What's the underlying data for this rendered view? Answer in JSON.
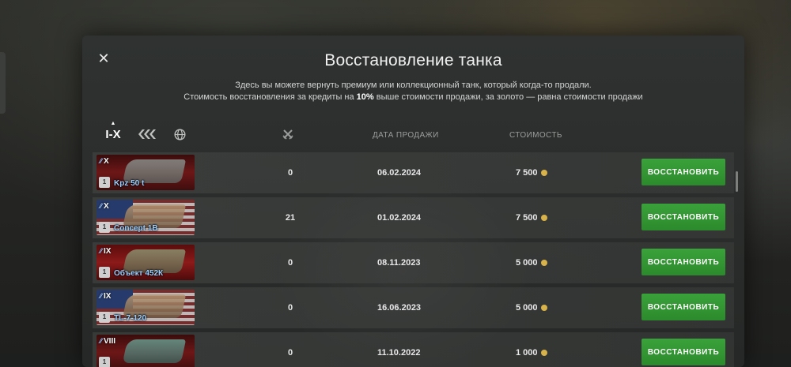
{
  "dialog": {
    "title": "Восстановление танка",
    "desc_line1": "Здесь вы можете вернуть премиум или коллекционный танк, который когда-то продали.",
    "desc_line2_pre": "Стоимость восстановления за кредиты на ",
    "desc_line2_bold": "10%",
    "desc_line2_post": " выше стоимости продажи, за золото — равна стоимости продажи"
  },
  "filters": {
    "tier_label": "I-X",
    "tier_arrow": "▲"
  },
  "columns": {
    "sale_date": "ДАТА ПРОДАЖИ",
    "cost": "СТОИМОСТЬ"
  },
  "rows": [
    {
      "tier": "X",
      "name": "Kpz 50 t",
      "battles": "0",
      "date": "06.02.2024",
      "cost": "7 500",
      "button": "ВОССТАНОВИТЬ"
    },
    {
      "tier": "X",
      "name": "Concept 1B",
      "battles": "21",
      "date": "01.02.2024",
      "cost": "7 500",
      "button": "ВОССТАНОВИТЬ"
    },
    {
      "tier": "IX",
      "name": "Объект 452К",
      "battles": "0",
      "date": "08.11.2023",
      "cost": "5 000",
      "button": "ВОССТАНОВИТЬ"
    },
    {
      "tier": "IX",
      "name": "TL-7-120",
      "battles": "0",
      "date": "16.06.2023",
      "cost": "5 000",
      "button": "ВОССТАНОВИТЬ"
    },
    {
      "tier": "VIII",
      "name": "",
      "battles": "0",
      "date": "11.10.2022",
      "cost": "1 000",
      "button": "ВОССТАНОВИТЬ"
    }
  ],
  "colors": {
    "accent_green": "#2f962f",
    "tank_name_blue": "#9fd0ff",
    "coin_gold": "#d8b24a"
  },
  "icons": [
    "close-icon",
    "tier-sort-arrow-icon",
    "vehicle-type-icon",
    "nation-globe-icon",
    "crossed-swords-icon",
    "premium-badge-icon",
    "credits-coin-icon"
  ]
}
